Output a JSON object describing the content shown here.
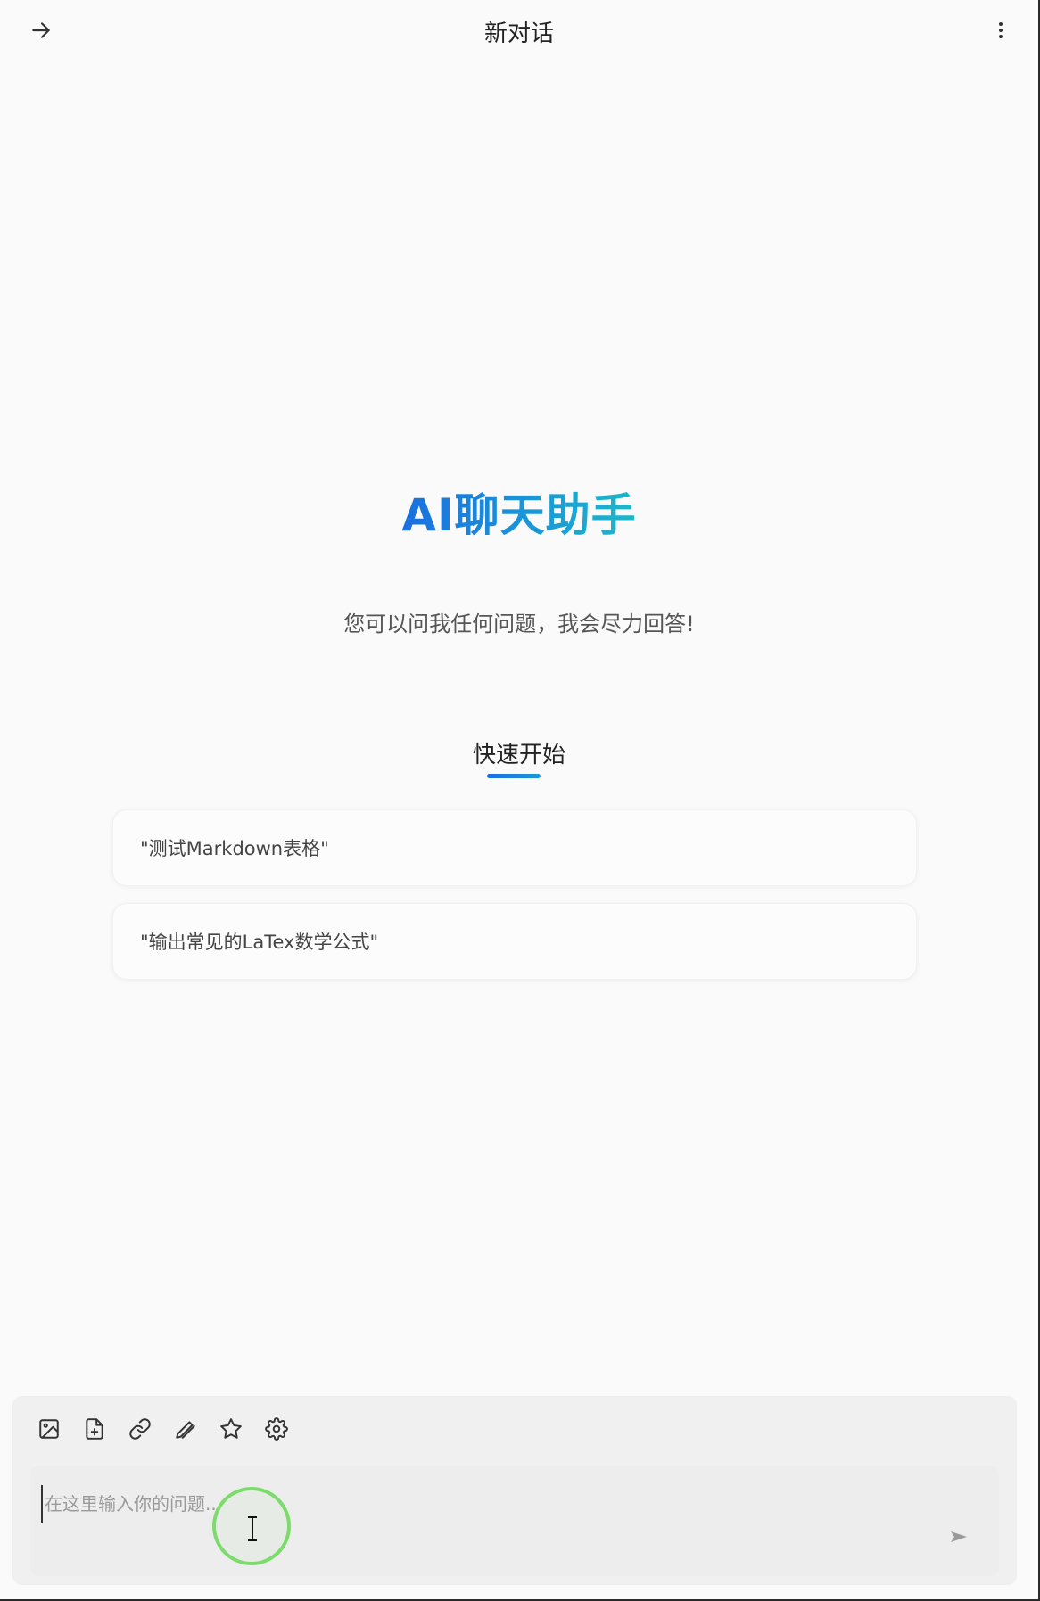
{
  "header": {
    "title": "新对话",
    "back_icon": "arrow-right-icon",
    "more_icon": "more-vertical-icon"
  },
  "welcome": {
    "title": "AI聊天助手",
    "subtitle": "您可以问我任何问题，我会尽力回答!",
    "accent_colors": [
      "#1a6fe0",
      "#1fb8c9"
    ]
  },
  "quick_start": {
    "title": "快速开始",
    "suggestions": [
      {
        "label": "\"测试Markdown表格\""
      },
      {
        "label": "\"输出常见的LaTex数学公式\""
      }
    ]
  },
  "composer": {
    "placeholder": "在这里输入你的问题...",
    "value": "",
    "tools": [
      "image-icon",
      "file-plus-icon",
      "link-icon",
      "draw-icon",
      "star-icon",
      "settings-icon"
    ],
    "send_icon": "send-icon"
  }
}
